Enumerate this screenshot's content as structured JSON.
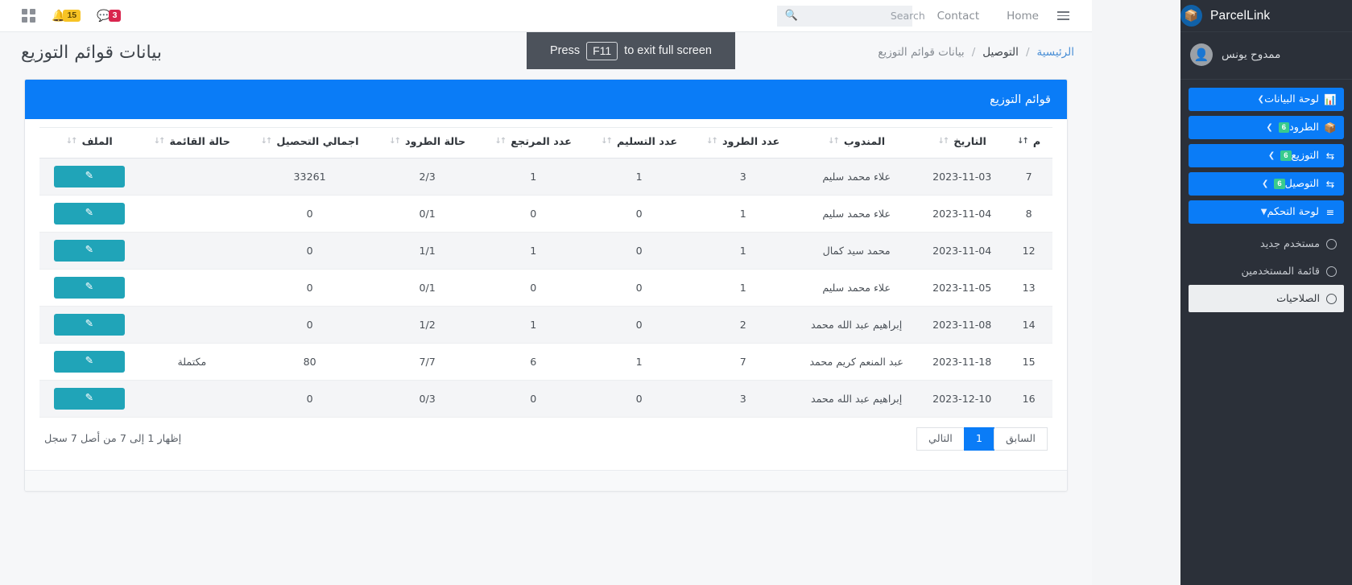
{
  "topbar": {
    "grid_icon": "grid-icon",
    "notifications": {
      "icon": "bell-icon",
      "count": "15"
    },
    "messages": {
      "icon": "chat-icon",
      "count": "3"
    },
    "search": {
      "icon": "search-icon",
      "placeholder": "Search",
      "value": ""
    },
    "links": [
      {
        "label": "Contact"
      },
      {
        "label": "Home"
      }
    ],
    "menu_icon": "hamburger-icon"
  },
  "fullscreen_hint": {
    "prefix": "Press",
    "key": "F11",
    "suffix": "to exit full screen"
  },
  "breadcrumb": {
    "items": [
      {
        "label": "الرئيسية",
        "type": "link"
      },
      {
        "label": "التوصيل",
        "type": "current"
      },
      {
        "label": "بيانات قوائم التوزيع",
        "type": "muted"
      }
    ],
    "separator": "/"
  },
  "page_title": "بيانات قوائم التوزيع",
  "card": {
    "header": "قوائم التوزيع",
    "columns": [
      {
        "key": "idx",
        "label": "م",
        "sorted": true
      },
      {
        "key": "date",
        "label": "التاريخ",
        "sorted": false
      },
      {
        "key": "agent",
        "label": "المندوب",
        "sorted": false
      },
      {
        "key": "parcels",
        "label": "عدد الطرود",
        "sorted": false
      },
      {
        "key": "delivered",
        "label": "عدد التسليم",
        "sorted": false
      },
      {
        "key": "returned",
        "label": "عدد المرتجع",
        "sorted": false
      },
      {
        "key": "status",
        "label": "حالة الطرود",
        "sorted": false
      },
      {
        "key": "collection",
        "label": "اجمالي التحصيل",
        "sorted": false
      },
      {
        "key": "liststatus",
        "label": "حالة القائمة",
        "sorted": false
      },
      {
        "key": "file",
        "label": "الملف",
        "sorted": false
      }
    ],
    "rows": [
      {
        "idx": "7",
        "date": "2023-11-03",
        "agent": "علاء محمد سليم",
        "parcels": "3",
        "delivered": "1",
        "returned": "1",
        "status": "2/3",
        "collection": "33261",
        "liststatus": "",
        "file_icon": "pencil-icon"
      },
      {
        "idx": "8",
        "date": "2023-11-04",
        "agent": "علاء محمد سليم",
        "parcels": "1",
        "delivered": "0",
        "returned": "0",
        "status": "0/1",
        "collection": "0",
        "liststatus": "",
        "file_icon": "pencil-icon"
      },
      {
        "idx": "12",
        "date": "2023-11-04",
        "agent": "محمد سيد كمال",
        "parcels": "1",
        "delivered": "0",
        "returned": "1",
        "status": "1/1",
        "collection": "0",
        "liststatus": "",
        "file_icon": "pencil-icon"
      },
      {
        "idx": "13",
        "date": "2023-11-05",
        "agent": "علاء محمد سليم",
        "parcels": "1",
        "delivered": "0",
        "returned": "0",
        "status": "0/1",
        "collection": "0",
        "liststatus": "",
        "file_icon": "pencil-icon"
      },
      {
        "idx": "14",
        "date": "2023-11-08",
        "agent": "إبراهيم عبد الله محمد",
        "parcels": "2",
        "delivered": "0",
        "returned": "1",
        "status": "1/2",
        "collection": "0",
        "liststatus": "",
        "file_icon": "pencil-icon"
      },
      {
        "idx": "15",
        "date": "2023-11-18",
        "agent": "عبد المنعم كريم محمد",
        "parcels": "7",
        "delivered": "1",
        "returned": "6",
        "status": "7/7",
        "collection": "80",
        "liststatus": "مكتملة",
        "file_icon": "pencil-icon"
      },
      {
        "idx": "16",
        "date": "2023-12-10",
        "agent": "إبراهيم عبد الله محمد",
        "parcels": "3",
        "delivered": "0",
        "returned": "0",
        "status": "0/3",
        "collection": "0",
        "liststatus": "",
        "file_icon": "pencil-icon"
      }
    ],
    "pagination": {
      "prev": "السابق",
      "pages": [
        "1"
      ],
      "next": "التالي",
      "info": "إظهار 1 إلى 7 من أصل 7 سجل"
    }
  },
  "sidebar": {
    "brand": "ParcelLink",
    "brand_icon": "parcel-logo-icon",
    "user": {
      "name": "ممدوح يونس",
      "avatar_icon": "user-avatar-icon"
    },
    "menu": [
      {
        "label": "لوحة البيانات",
        "icon": "dashboard-icon",
        "badge": "",
        "caret": "chevron-left-icon"
      },
      {
        "label": "الطرود",
        "icon": "boxes-icon",
        "badge": "6",
        "caret": "chevron-left-icon"
      },
      {
        "label": "التوزيع",
        "icon": "exchange-icon",
        "badge": "6",
        "caret": "chevron-left-icon"
      },
      {
        "label": "التوصيل",
        "icon": "exchange-icon",
        "badge": "6",
        "caret": "chevron-left-icon"
      },
      {
        "label": "لوحة التحكم",
        "icon": "server-icon",
        "badge": "",
        "caret": "chevron-down-icon"
      }
    ],
    "submenu": [
      {
        "label": "مستخدم جديد",
        "icon": "circle-icon",
        "hovered": false
      },
      {
        "label": "قائمة المستخدمين",
        "icon": "circle-icon",
        "hovered": false
      },
      {
        "label": "الصلاحيات",
        "icon": "circle-icon",
        "hovered": true
      }
    ]
  },
  "colors": {
    "accent_blue": "#0a7cf7",
    "sidebar_bg": "#2b3039",
    "teal_button": "#20a4b8",
    "badge_green": "#39cb8e",
    "badge_yellow": "#f7c325",
    "badge_red": "#d9254e"
  }
}
